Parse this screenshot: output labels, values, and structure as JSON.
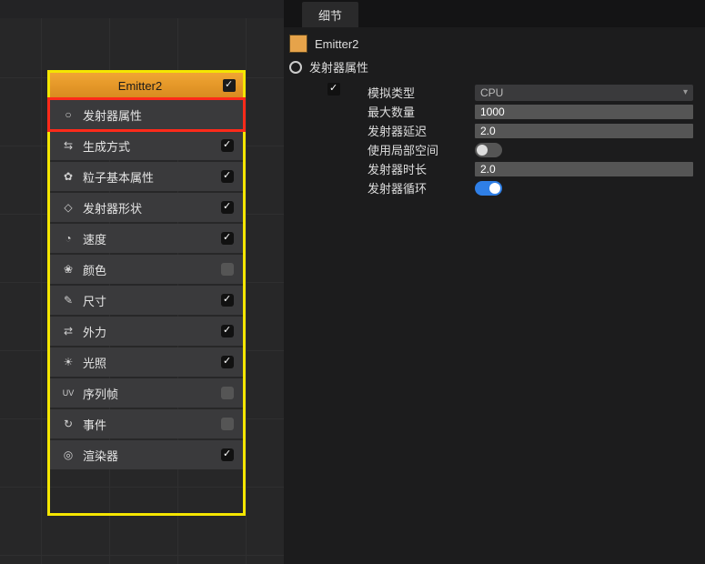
{
  "left": {
    "emitter_title": "Emitter2",
    "modules": [
      {
        "icon": "○",
        "label": "发射器属性",
        "checked": null,
        "selected": true
      },
      {
        "icon": "⇆",
        "label": "生成方式",
        "checked": true
      },
      {
        "icon": "✿",
        "label": "粒子基本属性",
        "checked": true
      },
      {
        "icon": "◇",
        "label": "发射器形状",
        "checked": true
      },
      {
        "icon": "◔",
        "label": "速度",
        "checked": true
      },
      {
        "icon": "❀",
        "label": "颜色",
        "checked": false
      },
      {
        "icon": "✎",
        "label": "尺寸",
        "checked": true
      },
      {
        "icon": "⇄",
        "label": "外力",
        "checked": true
      },
      {
        "icon": "☀",
        "label": "光照",
        "checked": true
      },
      {
        "icon": "UV",
        "label": "序列帧",
        "checked": false
      },
      {
        "icon": "↻",
        "label": "事件",
        "checked": false
      },
      {
        "icon": "◎",
        "label": "渲染器",
        "checked": true
      }
    ]
  },
  "right": {
    "tab_label": "细节",
    "object_name": "Emitter2",
    "section_title": "发射器属性",
    "section_enabled": true,
    "props": {
      "sim_type_label": "模拟类型",
      "sim_type_value": "CPU",
      "max_count_label": "最大数量",
      "max_count_value": "1000",
      "emitter_delay_label": "发射器延迟",
      "emitter_delay_value": "2.0",
      "use_local_space_label": "使用局部空间",
      "use_local_space_value": false,
      "emitter_duration_label": "发射器时长",
      "emitter_duration_value": "2.0",
      "emitter_loop_label": "发射器循环",
      "emitter_loop_value": true
    }
  }
}
